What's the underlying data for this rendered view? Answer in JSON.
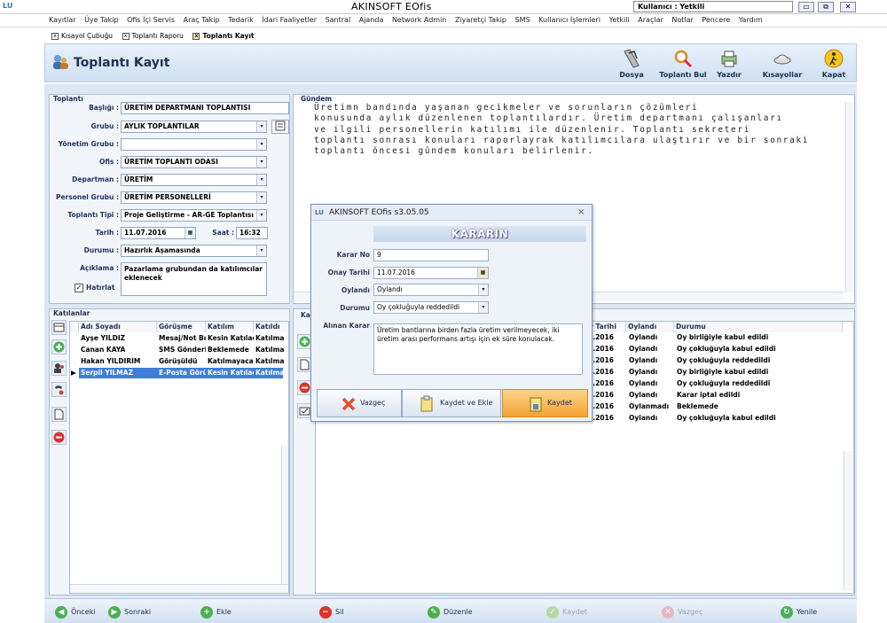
{
  "app": {
    "logo": "LU",
    "title": "AKINSOFT EOfis",
    "user": "Kullanıcı : Yetkili"
  },
  "window_controls": [
    "▭",
    "⧉",
    "✕"
  ],
  "menu": [
    "Kayıtlar",
    "Üye Takip",
    "Ofis İçi Servis",
    "Araç Takip",
    "Tedarik",
    "İdari Faaliyetler",
    "Santral",
    "Ajanda",
    "Network Admin",
    "Ziyaretçi Takip",
    "SMS",
    "Kullanıcı İşlemleri",
    "Yetkili",
    "Araçlar",
    "Notlar",
    "Pencere",
    "Yardım"
  ],
  "doc_tabs": [
    {
      "label": "Kısayol Çubuğu",
      "active": false
    },
    {
      "label": "Toplantı Raporu",
      "active": false
    },
    {
      "label": "Toplantı Kayıt",
      "active": true
    }
  ],
  "page_title": "Toplantı Kayıt",
  "toolbar": [
    {
      "label": "Dosya",
      "icon": "file-cabinet-icon"
    },
    {
      "label": "Toplantı Bul",
      "icon": "magnifier-icon"
    },
    {
      "label": "Yazdır",
      "icon": "printer-icon"
    },
    {
      "label": "Kısayollar",
      "icon": "shortcut-icon"
    },
    {
      "label": "Kapat",
      "icon": "exit-icon"
    }
  ],
  "toplanti": {
    "group_label": "Toplantı",
    "baslik_label": "Başlığı :",
    "baslik": "ÜRETİM DEPARTMANI TOPLANTISI",
    "grubu_label": "Grubu :",
    "grubu": "AYLIK TOPLANTILAR",
    "yonetim_label": "Yönetim Grubu :",
    "yonetim": "",
    "ofis_label": "Ofis :",
    "ofis": "ÜRETİM TOPLANTI ODASI",
    "departman_label": "Departman :",
    "departman": "ÜRETİM",
    "personel_label": "Personel Grubu :",
    "personel": "ÜRETİM PERSONELLERİ",
    "tipi_label": "Toplantı Tipi :",
    "tipi": "Proje Geliştirme - AR-GE Toplantısı",
    "tarih_label": "Tarih :",
    "tarih": "11.07.2016",
    "saat_label": "Saat :",
    "saat": "16:32",
    "durumu_label": "Durumu :",
    "durumu": "Hazırlık Aşamasında",
    "aciklama_label": "Açıklama :",
    "aciklama": "Pazarlama grubundan da katılımcılar eklenecek",
    "hatirlat_label": "Hatırlat",
    "hatirlat": true
  },
  "gundem": {
    "label": "Gündem",
    "text": "Üretimn bandında yaşanan gecikmeler ve sorunların çözümleri\nkonusunda aylık düzenlenen toplantılardır. Üretim departmanı çalışanları\nve ilgili personellerin katılımı ile düzenlenir. Toplantı sekreteri\ntoplantı sonrası konuları raporlayrak katılımcılara ulaştırır ve bir sonraki\ntoplantı öncesi gündem konuları belirlenir."
  },
  "katilanlar": {
    "label": "Katılanlar",
    "columns": [
      "Adı Soyadı",
      "Görüşme",
      "Katılım",
      "Katıldı"
    ],
    "rows": [
      [
        "Ayşe YILDIZ",
        "Mesaj/Not Bı",
        "Kesin Katılac",
        "Katılma"
      ],
      [
        "Canan KAYA",
        "SMS Gönderi",
        "Beklemede",
        "Katılma"
      ],
      [
        "Hakan YILDIRIM",
        "Görüşüldü",
        "Katılmayacal",
        "Katılma"
      ],
      [
        "Serpil YILMAZ",
        "E-Posta Görü",
        "Kesin Katılac",
        "Katılma"
      ]
    ],
    "selected_row": 3
  },
  "kararlar": {
    "label": "Ka",
    "columns": [
      "y Tarihi",
      "Oylandı",
      "Durumu"
    ],
    "rows": [
      [
        "7.2016",
        "Oylandı",
        "Oy birliğiyle kabul edildi"
      ],
      [
        "7.2016",
        "Oylandı",
        "Oy çokluğuyla kabul edildi"
      ],
      [
        "7.2016",
        "Oylandı",
        "Oy çokluğuyla reddedildi"
      ],
      [
        "7.2016",
        "Oylandı",
        "Oy birliğiyle kabul edildi"
      ],
      [
        "7.2016",
        "Oylandı",
        "Oy çokluğuyla reddedildi"
      ],
      [
        "7.2016",
        "Oylandı",
        "Karar iptal edildi"
      ],
      [
        "7.2016",
        "Oylanmadı",
        "Beklemede"
      ],
      [
        "7.2016",
        "Oylandı",
        "Oy çokluğuyla kabul edildi"
      ]
    ]
  },
  "bottom_bar": [
    {
      "label": "Önceki",
      "color": "#4caf50",
      "glyph": "◀",
      "enabled": true
    },
    {
      "label": "Sonraki",
      "color": "#4caf50",
      "glyph": "▶",
      "enabled": true
    },
    {
      "label": "Ekle",
      "color": "#4caf50",
      "glyph": "+",
      "enabled": true
    },
    {
      "label": "Sil",
      "color": "#d9342b",
      "glyph": "−",
      "enabled": true
    },
    {
      "label": "Düzenle",
      "color": "#4caf50",
      "glyph": "✎",
      "enabled": true
    },
    {
      "label": "Kaydet",
      "color": "#b7d7a8",
      "glyph": "✓",
      "enabled": false
    },
    {
      "label": "Vazgeç",
      "color": "#e8b7c4",
      "glyph": "✕",
      "enabled": false
    },
    {
      "label": "Yenile",
      "color": "#4caf50",
      "glyph": "↻",
      "enabled": true
    }
  ],
  "dialog": {
    "title": "AKINSOFT EOfis s3.05.05",
    "heading": "KARARIN",
    "karar_no_label": "Karar No",
    "karar_no": "9",
    "onay_label": "Onay Tarihi",
    "onay_tarihi": "11.07.2016",
    "oylandi_label": "Oylandı",
    "oylandi": "Oylandı",
    "durumu_label": "Durumu",
    "durumu": "Oy çokluğuyla reddedildi",
    "alinan_label": "Alınan Karar",
    "alinan_karar": "Üretim bantlarına birden fazla üretim verilmeyecek, iki üretim arası performans artışı için ek süre konulacak.",
    "buttons": {
      "vazgec": "Vazgeç",
      "kaydet_ekle": "Kaydet ve Ekle",
      "kaydet": "Kaydet"
    }
  },
  "colors": {
    "accent": "#3f7fd7",
    "panel": "#f2f6fb",
    "dialog_save": "#f7b24a"
  }
}
